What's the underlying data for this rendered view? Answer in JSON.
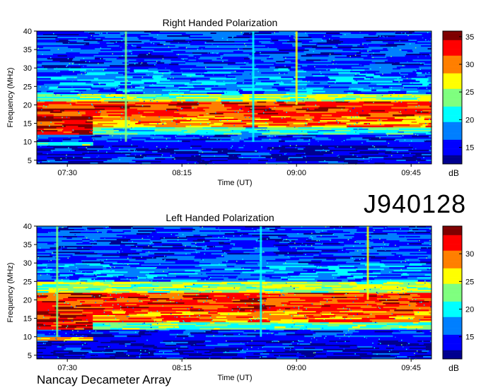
{
  "page": {
    "identifier": "J940128",
    "footer": "Nancay Decameter Array"
  },
  "colors": {
    "map": [
      "#00008f",
      "#0000ff",
      "#007fff",
      "#00ffff",
      "#7fff7f",
      "#ffff00",
      "#ff7f00",
      "#ff0000",
      "#7f0000"
    ],
    "frame": "#000000"
  },
  "chart_data": [
    {
      "type": "heatmap",
      "title": "Right Handed Polarization",
      "xlabel": "Time (UT)",
      "ylabel": "Frequency (MHz)",
      "colorbar_label": "dB",
      "xticks": [
        "07:30",
        "08:15",
        "09:00",
        "09:45"
      ],
      "xtick_minutes": [
        450,
        495,
        540,
        585
      ],
      "xlim_minutes": [
        438,
        593
      ],
      "yticks": [
        5,
        10,
        15,
        20,
        25,
        30,
        35,
        40
      ],
      "ylim": [
        4,
        40
      ],
      "colorbar_ticks": [
        15,
        20,
        25,
        30,
        35
      ],
      "colorbar_range": [
        12,
        36
      ],
      "bands": [
        {
          "f": [
            4,
            9
          ],
          "t": [
            438,
            593
          ],
          "db": 14
        },
        {
          "f": [
            9,
            10
          ],
          "t": [
            438,
            460
          ],
          "db": 23
        },
        {
          "f": [
            10,
            12
          ],
          "t": [
            438,
            593
          ],
          "db": 16
        },
        {
          "f": [
            12,
            17.5
          ],
          "t": [
            438,
            460
          ],
          "db": 34
        },
        {
          "f": [
            12,
            14
          ],
          "t": [
            460,
            593
          ],
          "db": 22
        },
        {
          "f": [
            14,
            17
          ],
          "t": [
            460,
            593
          ],
          "db": 30
        },
        {
          "f": [
            17,
            21
          ],
          "t": [
            438,
            593
          ],
          "db": 32
        },
        {
          "f": [
            21,
            23
          ],
          "t": [
            438,
            593
          ],
          "db": 25
        },
        {
          "f": [
            23,
            30
          ],
          "t": [
            438,
            593
          ],
          "db": 18
        },
        {
          "f": [
            30,
            40
          ],
          "t": [
            438,
            593
          ],
          "db": 16
        }
      ],
      "bursts": [
        {
          "t": 473,
          "f": [
            10,
            40
          ],
          "db": 24
        },
        {
          "t": 523,
          "f": [
            10,
            40
          ],
          "db": 22
        },
        {
          "t": 540,
          "f": [
            20,
            40
          ],
          "db": 26
        }
      ]
    },
    {
      "type": "heatmap",
      "title": "Left Handed Polarization",
      "xlabel": "Time (UT)",
      "ylabel": "Frequency (MHz)",
      "colorbar_label": "dB",
      "xticks": [
        "07:30",
        "08:15",
        "09:00",
        "09:45"
      ],
      "xtick_minutes": [
        450,
        495,
        540,
        585
      ],
      "xlim_minutes": [
        438,
        593
      ],
      "yticks": [
        5,
        10,
        15,
        20,
        25,
        30,
        35,
        40
      ],
      "ylim": [
        4,
        40
      ],
      "colorbar_ticks": [
        15,
        20,
        25,
        30
      ],
      "colorbar_range": [
        11,
        35
      ],
      "bands": [
        {
          "f": [
            4,
            9
          ],
          "t": [
            438,
            593
          ],
          "db": 13
        },
        {
          "f": [
            9,
            10
          ],
          "t": [
            438,
            460
          ],
          "db": 27
        },
        {
          "f": [
            10,
            12
          ],
          "t": [
            438,
            593
          ],
          "db": 15
        },
        {
          "f": [
            12,
            17.5
          ],
          "t": [
            438,
            460
          ],
          "db": 33
        },
        {
          "f": [
            12,
            14
          ],
          "t": [
            460,
            593
          ],
          "db": 22
        },
        {
          "f": [
            14,
            17
          ],
          "t": [
            460,
            593
          ],
          "db": 29
        },
        {
          "f": [
            17,
            22
          ],
          "t": [
            438,
            593
          ],
          "db": 31
        },
        {
          "f": [
            22,
            25
          ],
          "t": [
            438,
            593
          ],
          "db": 24
        },
        {
          "f": [
            25,
            30
          ],
          "t": [
            438,
            593
          ],
          "db": 17
        },
        {
          "f": [
            30,
            40
          ],
          "t": [
            438,
            593
          ],
          "db": 15
        }
      ],
      "bursts": [
        {
          "t": 446,
          "f": [
            10,
            40
          ],
          "db": 23
        },
        {
          "t": 526,
          "f": [
            10,
            40
          ],
          "db": 21
        },
        {
          "t": 568,
          "f": [
            20,
            40
          ],
          "db": 27
        }
      ]
    }
  ]
}
